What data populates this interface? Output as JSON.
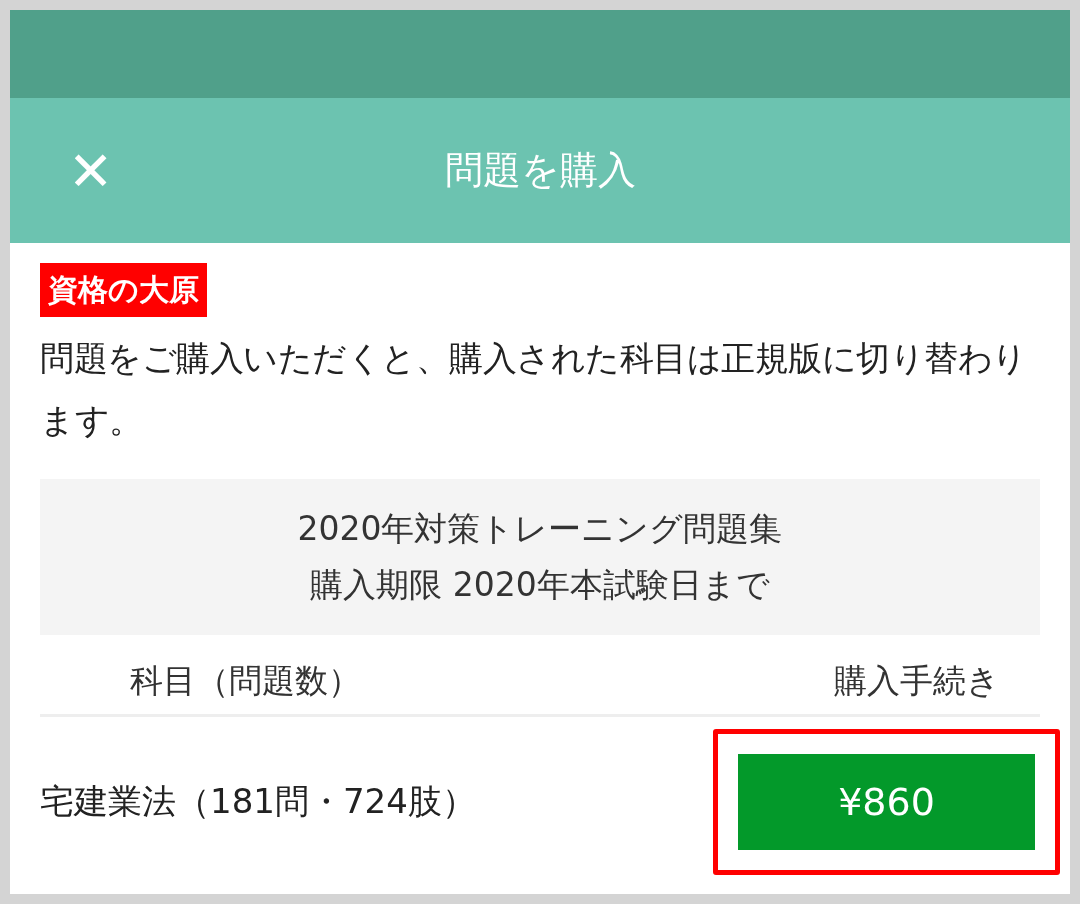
{
  "header": {
    "close": "✕",
    "title": "問題を購入"
  },
  "brand": "資格の大原",
  "message": "問題をご購入いただくと、購入された科目は正規版に切り替わります。",
  "product": {
    "name": "2020年対策トレーニング問題集",
    "deadline": "購入期限 2020年本試験日まで"
  },
  "table": {
    "columns": [
      "科目（問題数）",
      "購入手続き"
    ],
    "rows": [
      {
        "subject": "宅建業法（181問・724肢）",
        "price": "¥860",
        "highlighted": true
      }
    ]
  }
}
